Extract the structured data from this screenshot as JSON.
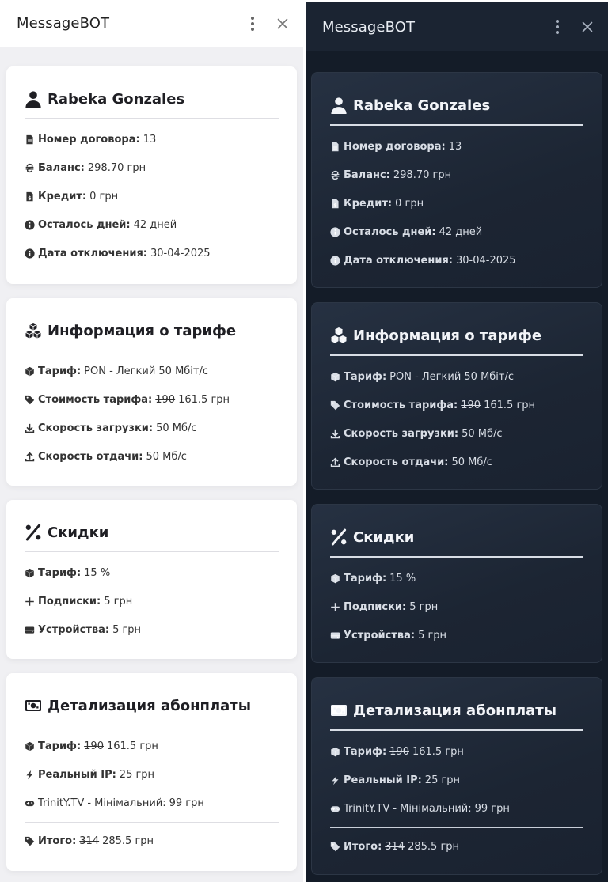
{
  "app": {
    "title": "MessageBOT"
  },
  "subscriber": {
    "name": "Rabeka Gonzales",
    "contract_label": "Номер договора:",
    "contract_value": "13",
    "balance_label": "Баланс:",
    "balance_value": "298.70 грн",
    "credit_label": "Кредит:",
    "credit_value": "0 грн",
    "days_label": "Осталось дней:",
    "days_value": "42 дней",
    "off_label": "Дата отключения:",
    "off_value": "30-04-2025"
  },
  "tariff": {
    "title": "Информация о тарифе",
    "tariff_label": "Тариф:",
    "tariff_name": "PON - Легкий 50 Мбіт/с",
    "price_label": "Стоимость тарифа:",
    "price_old": "190",
    "price_new": "161.5 грн",
    "down_label": "Скорость загрузки:",
    "down_value": "50 Мб/с",
    "up_label": "Скорость отдачи:",
    "up_value": "50 Мб/с"
  },
  "discounts": {
    "title": "Скидки",
    "tariff_label": "Тариф:",
    "tariff_value": "15 %",
    "subs_label": "Подписки:",
    "subs_value": "5 грн",
    "devices_label": "Устройства:",
    "devices_value": "5 грн"
  },
  "fee": {
    "title": "Детализация абонплаты",
    "tariff_label": "Тариф:",
    "tariff_old": "190",
    "tariff_new": "161.5 грн",
    "ip_label": "Реальный IP:",
    "ip_value": "25 грн",
    "tv_name": "TrinitY.TV - Мінімальний:",
    "tv_value": "99 грн",
    "total_label": "Итого:",
    "total_old": "314",
    "total_new": "285.5 грн"
  },
  "icons": {
    "kebab": "kebab-menu-icon",
    "close": "close-icon",
    "user": "user-icon",
    "contract": "document-icon",
    "balance": "hryvnia-icon",
    "credit": "invoice-icon",
    "info": "info-icon",
    "cubes": "cubes-icon",
    "cube": "cube-icon",
    "tag": "tag-icon",
    "download": "download-icon",
    "upload": "upload-icon",
    "percent": "percent-icon",
    "plus": "plus-icon",
    "device": "hdd-icon",
    "money": "money-bill-icon",
    "bolt": "bolt-icon",
    "gamepad": "gamepad-icon"
  },
  "theme": {
    "light_bg": "#f0f0f3",
    "dark_bg": "#141c28",
    "dark_card": "#1f2937"
  }
}
